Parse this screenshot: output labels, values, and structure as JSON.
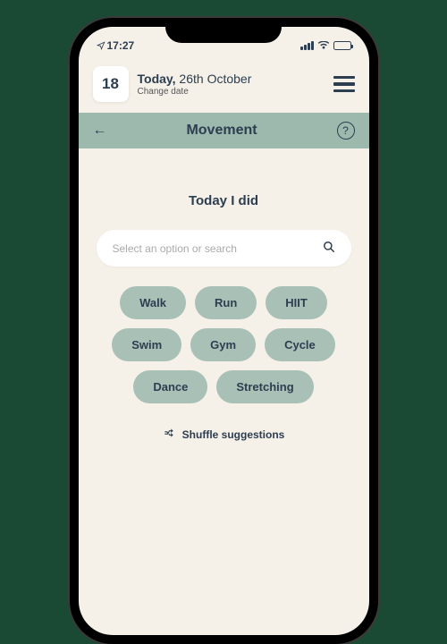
{
  "status": {
    "time": "17:27"
  },
  "header": {
    "day": "18",
    "today_prefix": "Today,",
    "date_rest": " 26th October",
    "change": "Change date"
  },
  "section": {
    "title": "Movement"
  },
  "content": {
    "prompt": "Today I did",
    "search_placeholder": "Select an option or search",
    "chips": [
      "Walk",
      "Run",
      "HIIT",
      "Swim",
      "Gym",
      "Cycle",
      "Dance",
      "Stretching"
    ],
    "shuffle": "Shuffle suggestions"
  }
}
